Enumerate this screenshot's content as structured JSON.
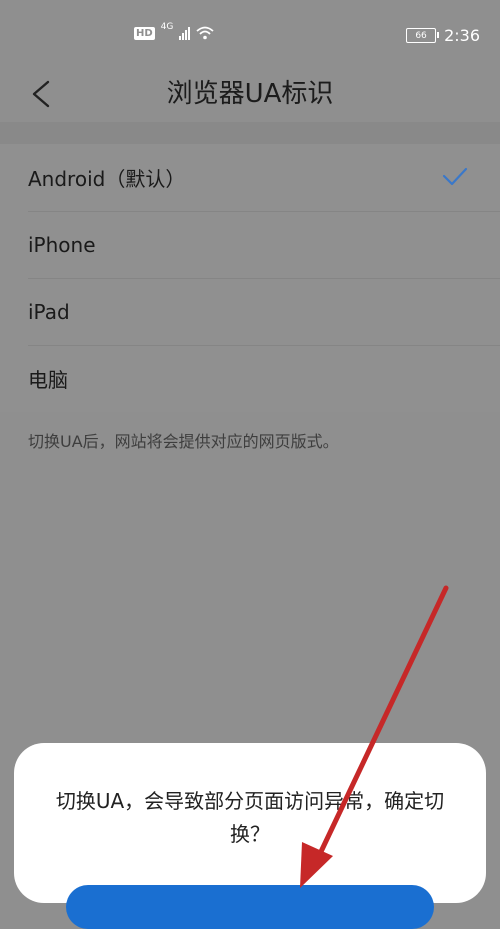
{
  "status_bar": {
    "hd": "HD",
    "network": "4G",
    "battery": "66",
    "time": "2:36"
  },
  "header": {
    "title": "浏览器UA标识",
    "back_icon": "chevron-left-icon"
  },
  "ua_options": [
    {
      "label": "Android（默认）",
      "selected": true
    },
    {
      "label": "iPhone",
      "selected": false
    },
    {
      "label": "iPad",
      "selected": false
    },
    {
      "label": "电脑",
      "selected": false
    }
  ],
  "hint": "切换UA后，网站将会提供对应的网页版式。",
  "dialog": {
    "message": "切换UA，会导致部分页面访问异常，确定切换？"
  },
  "colors": {
    "accent": "#3a78c9",
    "button": "#1a6fd1",
    "annotation_arrow": "#c62828"
  }
}
